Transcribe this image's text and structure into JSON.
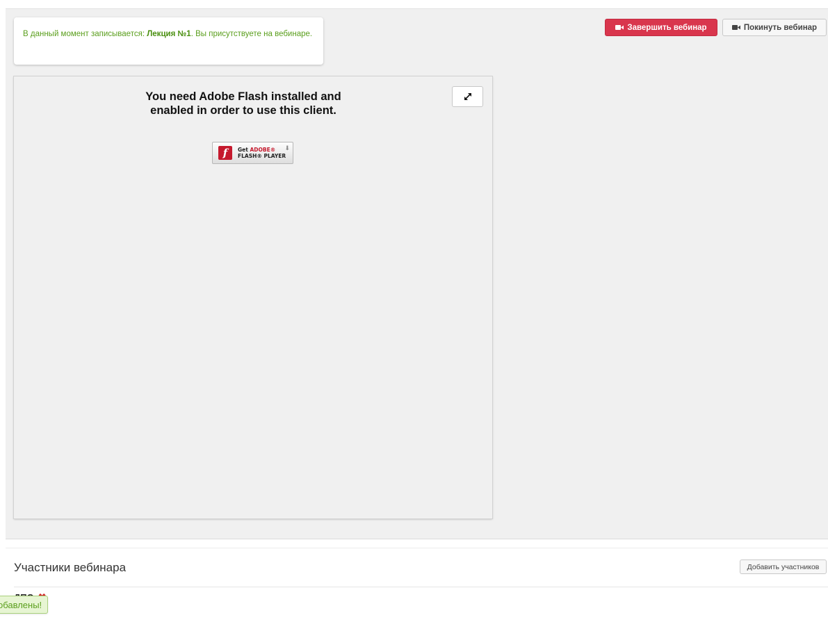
{
  "notice": {
    "prefix": "В данный момент записывается: ",
    "lecture": "Лекция №1",
    "suffix": ". Вы присутствуете на вебинаре."
  },
  "toolbar": {
    "end_webinar": "Завершить вебинар",
    "leave_webinar": "Покинуть вебинар",
    "end_color": "#d9364d"
  },
  "flash": {
    "message": "You need Adobe Flash installed and enabled in order to use this client.",
    "badge_line1_get": "Get ",
    "badge_line1_adobe": "ADOBE®",
    "badge_line2": "FLASH® PLAYER",
    "expand_icon": "expand-arrows-icon"
  },
  "participants": {
    "title": "Участники вебинара",
    "add_button": "Добавить участников",
    "items": [
      {
        "label": "ДПО"
      }
    ]
  },
  "toast": {
    "text": "обавлены!"
  }
}
